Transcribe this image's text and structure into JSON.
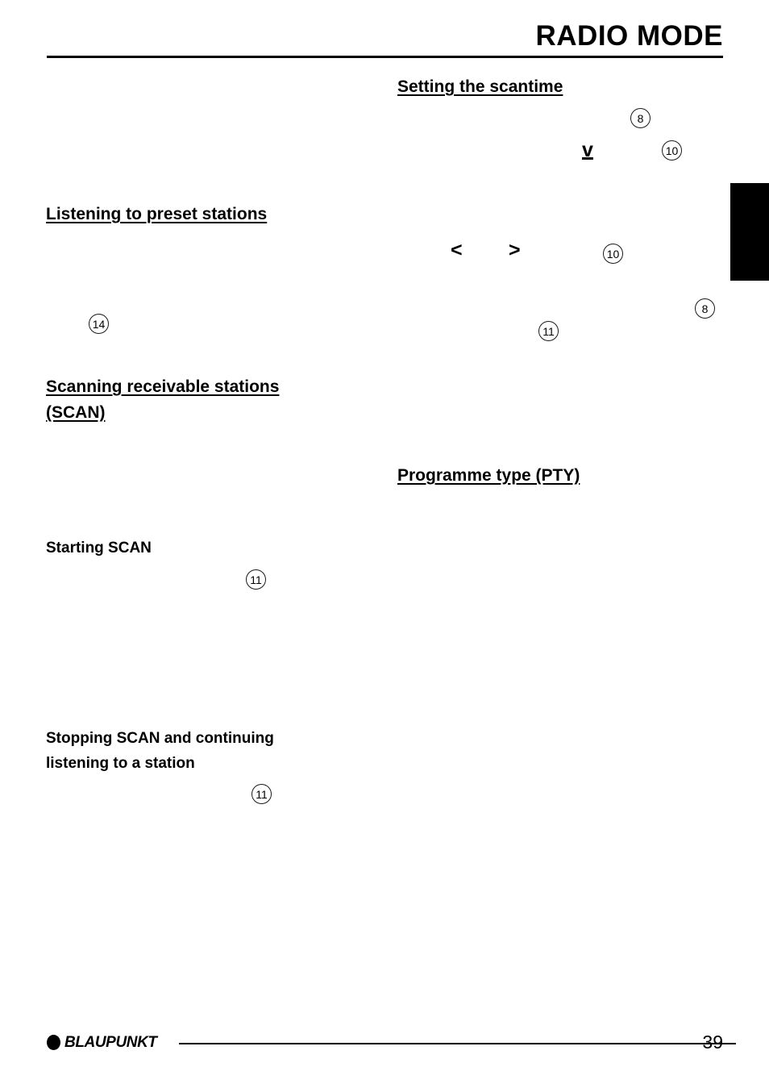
{
  "document": {
    "chapter_title": "RADIO MODE",
    "page_number": "39",
    "brand": "BLAUPUNKT"
  },
  "left_column": {
    "headings": [
      {
        "id": "listening-preset-stations",
        "text": "Listening to preset stations",
        "underlined": true
      },
      {
        "id": "scanning-receivable-stations-line1",
        "text": "Scanning receivable stations",
        "underlined": true
      },
      {
        "id": "scanning-receivable-stations-line2",
        "text": "(SCAN)",
        "underlined": true
      }
    ],
    "subheadings": [
      {
        "id": "starting-scan",
        "text": "Starting SCAN"
      },
      {
        "id": "stopping-scan-line1",
        "text": "Stopping SCAN and continuing"
      },
      {
        "id": "stopping-scan-line2",
        "text": "listening to a station"
      }
    ],
    "references": [
      {
        "id": "ref-14",
        "label": "14"
      },
      {
        "id": "ref-11-starting-scan",
        "label": "11"
      },
      {
        "id": "ref-11-stopping-scan",
        "label": "11"
      }
    ]
  },
  "right_column": {
    "headings": [
      {
        "id": "setting-the-scantime",
        "text": "Setting the scantime",
        "underlined": true
      },
      {
        "id": "programme-type-pty",
        "text": "Programme type (PTY)",
        "underlined": true
      }
    ],
    "references": [
      {
        "id": "ref-8-scantime",
        "label": "8"
      },
      {
        "id": "ref-10-scantime",
        "label": "10"
      },
      {
        "id": "ref-10-arrows",
        "label": "10"
      },
      {
        "id": "ref-8-right",
        "label": "8"
      },
      {
        "id": "ref-11-right",
        "label": "11"
      }
    ],
    "glyphs": [
      {
        "id": "glyph-down-key",
        "text": "v",
        "underlined": true
      },
      {
        "id": "glyph-left-arrow",
        "text": "<",
        "underlined": false
      },
      {
        "id": "glyph-right-arrow",
        "text": ">",
        "underlined": false
      }
    ]
  }
}
